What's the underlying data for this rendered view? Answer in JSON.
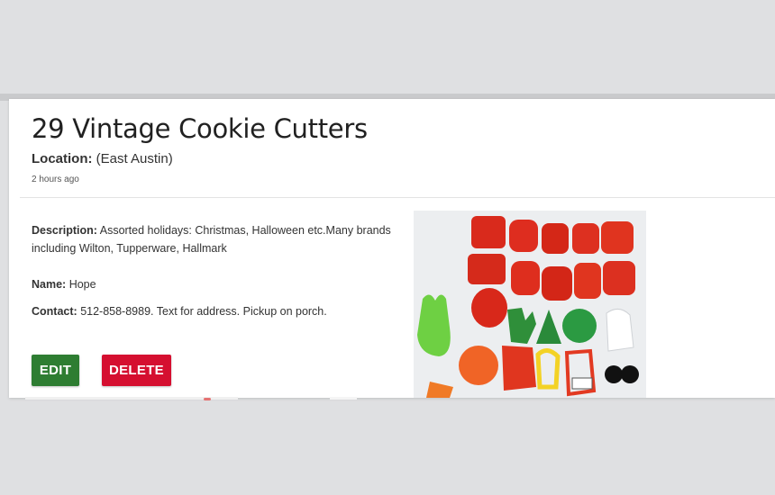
{
  "listing": {
    "title": "29 Vintage Cookie Cutters",
    "location_label": "Location:",
    "location_value": "(East Austin)",
    "posted": "2 hours ago",
    "description_label": "Description:",
    "description_value": "Assorted holidays: Christmas, Halloween etc.Many brands including Wilton, Tupperware, Hallmark",
    "name_label": "Name:",
    "name_value": "Hope",
    "contact_label": "Contact:",
    "contact_value": "512-858-8989. Text for address. Pickup on porch."
  },
  "actions": {
    "edit_label": "EDIT",
    "delete_label": "DELETE"
  },
  "colors": {
    "edit": "#2e7d32",
    "delete": "#d50f30",
    "page_bg": "#dfe0e2"
  },
  "image": {
    "subject": "cookie-cutters-photo"
  }
}
